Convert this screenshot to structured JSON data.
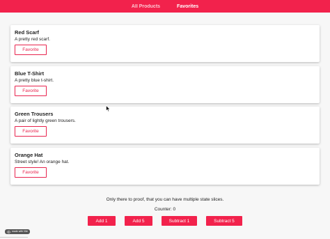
{
  "nav": {
    "all_products": "All Products",
    "favorites": "Favorites"
  },
  "products": [
    {
      "title": "Red Scarf",
      "description": "A pretty red scarf.",
      "button": "Favorite"
    },
    {
      "title": "Blue T-Shirt",
      "description": "A pretty blue t-shirt.",
      "button": "Favorite"
    },
    {
      "title": "Green Trousers",
      "description": "A pair of lightly green trousers.",
      "button": "Favorite"
    },
    {
      "title": "Orange Hat",
      "description": "Street style! An orange hat.",
      "button": "Favorite"
    }
  ],
  "info": {
    "note": "Only there to proof, that you can have multiple state slices.",
    "counter": "Counter: 0"
  },
  "actions": {
    "add1": "Add 1",
    "add5": "Add 5",
    "sub1": "Subtract 1",
    "sub5": "Subtract 5"
  },
  "badge": {
    "label": "made with Vite"
  },
  "colors": {
    "accent": "#f2224c",
    "background": "#f7f7f7"
  },
  "icons": {
    "cursor": "mouse-pointer-icon",
    "badge": "eye-icon"
  }
}
